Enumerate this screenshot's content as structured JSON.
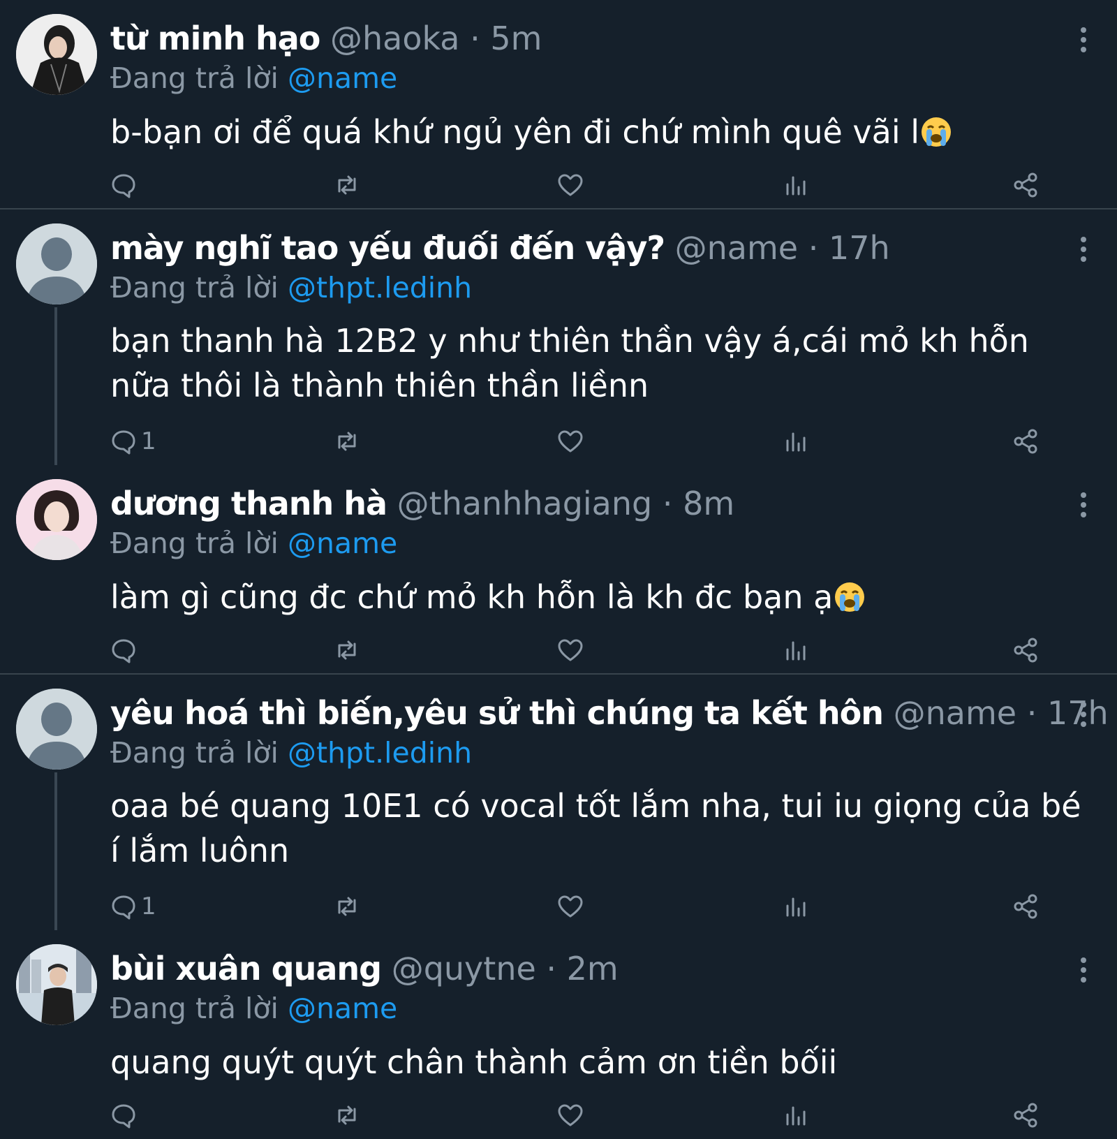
{
  "tweets": [
    {
      "name": "từ minh hạo",
      "handle": "@haoka",
      "sep": "·",
      "time": "5m",
      "replying_label": "Đang trả lời",
      "replying_to": "@name",
      "body": "b-bạn ơi để quá khứ ngủ yên đi chứ mình quê vãi l",
      "trailing_emoji": "loudly-crying-face",
      "reply_count": ""
    },
    {
      "name": "mày nghĩ tao yếu đuối đến vậy?",
      "handle": "@name",
      "sep": "·",
      "time": "17h",
      "replying_label": "Đang trả lời",
      "replying_to": "@thpt.ledinh",
      "body": "bạn thanh hà 12B2 y như thiên thần vậy á,cái mỏ kh hỗn nữa thôi là thành thiên thần liềnn",
      "reply_count": "1"
    },
    {
      "name": "dương thanh hà",
      "handle": "@thanhhagiang",
      "sep": "·",
      "time": "8m",
      "replying_label": "Đang trả lời",
      "replying_to": "@name",
      "body": "làm gì cũng đc chứ mỏ kh hỗn là kh đc bạn ạ",
      "trailing_emoji": "loudly-crying-face",
      "reply_count": ""
    },
    {
      "name": "yêu hoá thì biến,yêu sử thì chúng ta kết hôn",
      "handle": "@name",
      "sep": "·",
      "time": "17h",
      "replying_label": "Đang trả lời",
      "replying_to": "@thpt.ledinh",
      "body": "oaa bé quang 10E1 có vocal tốt lắm nha, tui iu giọng của bé í lắm luônn",
      "reply_count": "1"
    },
    {
      "name": "bùi xuân quang",
      "handle": "@quytne",
      "sep": "·",
      "time": "2m",
      "replying_label": "Đang trả lời",
      "replying_to": "@name",
      "body": "quang quýt quýt chân thành cảm ơn tiền bốii",
      "reply_count": ""
    }
  ],
  "icons": {
    "reply": "reply-icon",
    "retweet": "retweet-icon",
    "like": "heart-icon",
    "views": "views-icon",
    "share": "share-icon",
    "more": "more-vertical-icon"
  },
  "colors": {
    "background": "#15202b",
    "accent": "#1d9bf0",
    "secondary_text": "#8b98a5",
    "divider": "#38444d"
  }
}
